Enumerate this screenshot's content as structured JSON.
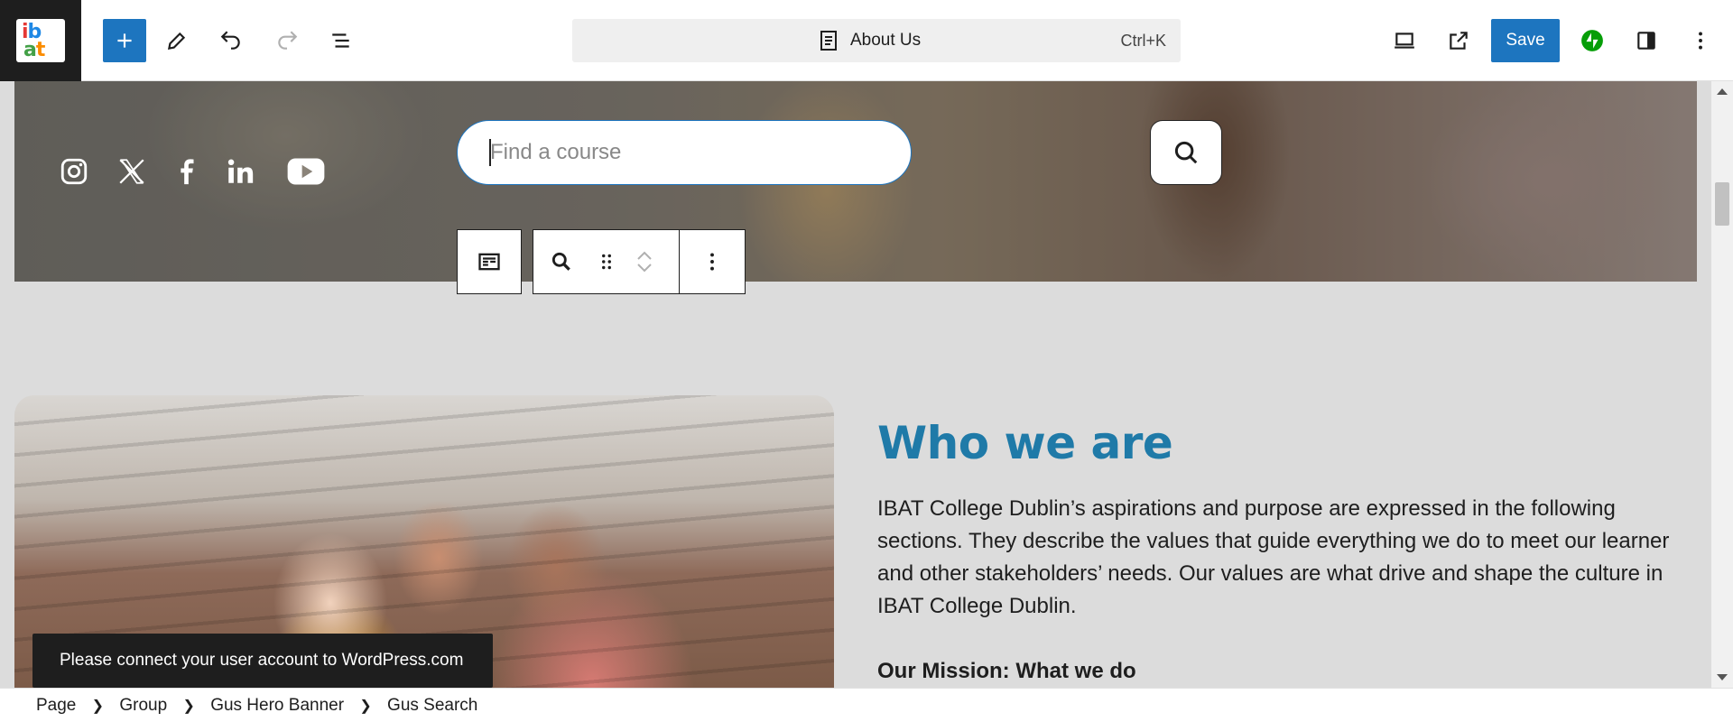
{
  "topbar": {
    "document_title": "About Us",
    "shortcut": "Ctrl+K",
    "save_label": "Save"
  },
  "hero": {
    "search_placeholder": "Find a course"
  },
  "content": {
    "heading": "Who we are",
    "paragraph": "IBAT College Dublin’s aspirations and purpose are expressed in the following sections. They describe the values that guide everything we do to meet our learner and other stakeholders’ needs. Our values are what drive and shape the culture in IBAT College Dublin.",
    "subheading": "Our Mission: What we do"
  },
  "notice": {
    "text": "Please connect your user account to WordPress.com"
  },
  "breadcrumb": [
    "Page",
    "Group",
    "Gus Hero Banner",
    "Gus Search"
  ],
  "colors": {
    "accent": "#1d75bf",
    "heading": "#1f7aa8",
    "jetpack": "#069e08"
  }
}
